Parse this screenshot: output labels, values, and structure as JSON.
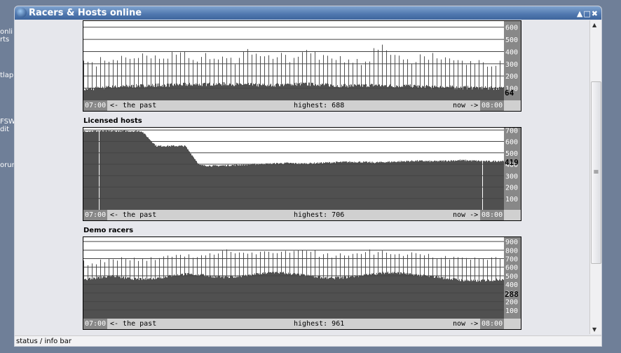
{
  "window": {
    "title": "Racers & Hosts online",
    "controls": "▲□✖"
  },
  "desktop": [
    "onli",
    "rts",
    "tlap",
    "FSW",
    "dit",
    "orum"
  ],
  "status_bar": "status / info bar",
  "colors": {
    "fill": "#505050",
    "axis_strip": "#888888",
    "footer": "#d0d0d0",
    "titlebar": "#4f77ae"
  },
  "chart_data": [
    {
      "type": "area",
      "title": "",
      "start": "07:00",
      "end": "08:00",
      "past_label": "<- the past",
      "now_label": "now ->",
      "highest_label": "highest: 688",
      "current": "64",
      "yticks": [
        100,
        200,
        300,
        400,
        500,
        600
      ],
      "ylim": [
        0,
        650
      ],
      "baseline": [
        90,
        100,
        110,
        115,
        120,
        125,
        125,
        130,
        130,
        135,
        135,
        130,
        125,
        125,
        130,
        135,
        130,
        125,
        120,
        120,
        125,
        120,
        120,
        115,
        110,
        110,
        105,
        105,
        100,
        100
      ],
      "peaks": [
        300,
        330,
        340,
        350,
        360,
        330,
        380,
        330,
        360,
        340,
        320,
        400,
        350,
        370,
        340,
        400,
        360,
        340,
        320,
        300,
        430,
        380,
        330,
        350,
        360,
        320,
        310,
        300,
        300,
        310
      ]
    },
    {
      "type": "area",
      "title": "Licensed hosts",
      "start": "07:00",
      "end": "08:00",
      "past_label": "<- the past",
      "now_label": "now ->",
      "highest_label": "highest: 706",
      "current": "419",
      "yticks": [
        100,
        200,
        300,
        400,
        500,
        600,
        700
      ],
      "ylim": [
        0,
        720
      ],
      "baseline": [
        690,
        690,
        690,
        690,
        690,
        560,
        560,
        560,
        390,
        385,
        390,
        395,
        400,
        405,
        410,
        405,
        410,
        415,
        420,
        420,
        415,
        420,
        425,
        430,
        425,
        430,
        435,
        430,
        425,
        430
      ],
      "peaks": []
    },
    {
      "type": "area",
      "title": "Demo racers",
      "start": "07:00",
      "end": "08:00",
      "past_label": "<- the past",
      "now_label": "now ->",
      "highest_label": "highest: 961",
      "current": "288",
      "yticks": [
        100,
        200,
        300,
        400,
        500,
        600,
        700,
        800,
        900
      ],
      "ylim": [
        0,
        950
      ],
      "baseline": [
        450,
        480,
        500,
        470,
        460,
        470,
        500,
        520,
        510,
        490,
        480,
        500,
        520,
        540,
        530,
        510,
        490,
        470,
        480,
        500,
        520,
        540,
        530,
        510,
        490,
        470,
        450,
        440,
        450,
        460
      ],
      "peaks": [
        650,
        680,
        700,
        690,
        700,
        720,
        740,
        730,
        760,
        780,
        770,
        750,
        760,
        780,
        790,
        770,
        750,
        740,
        760,
        780,
        770,
        760,
        750,
        740,
        730,
        720,
        700,
        690,
        700,
        720
      ]
    }
  ]
}
